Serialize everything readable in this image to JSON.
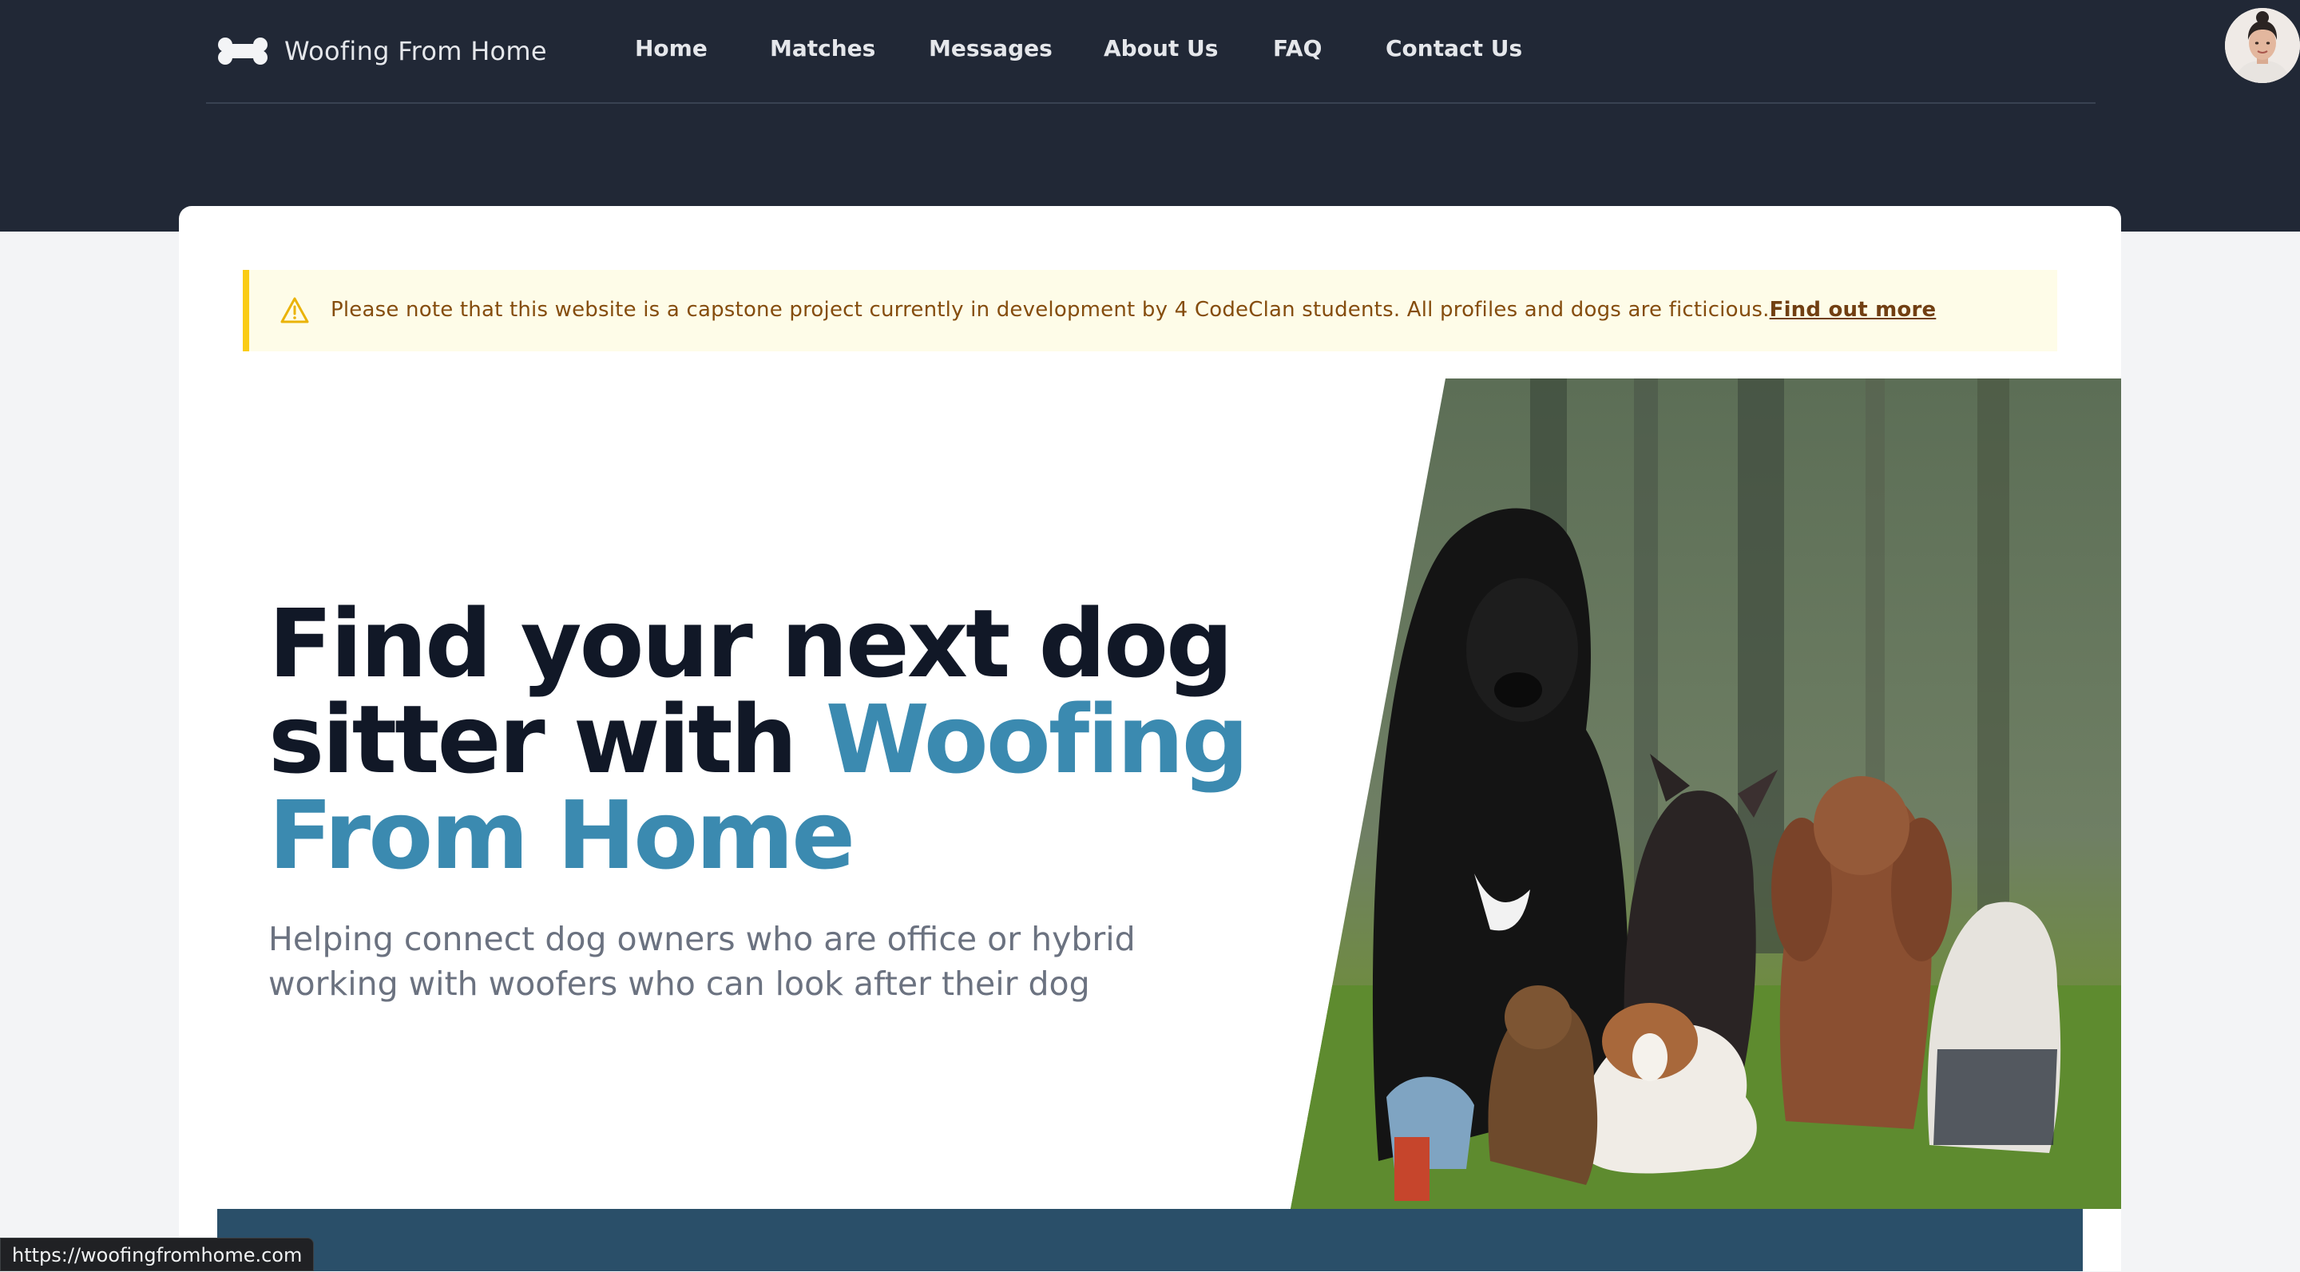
{
  "brand": {
    "name": "Woofing From Home",
    "icon": "bone-icon"
  },
  "nav": {
    "links": [
      "Home",
      "Matches",
      "Messages",
      "About Us",
      "FAQ",
      "Contact Us"
    ]
  },
  "user": {
    "avatar": "user-avatar"
  },
  "notice": {
    "icon": "warning-triangle-icon",
    "text": "Please note that this website is a capstone project currently in development by 4 CodeClan students. All profiles and dogs are ficticious.",
    "link_text": "Find out more"
  },
  "hero": {
    "title_part1": "Find your next dog sitter with ",
    "title_accent": "Woofing From Home",
    "subtitle": "Helping connect dog owners who are office or hybrid working with woofers who can look after their dog",
    "image": "group-of-dogs-photo"
  },
  "status_bar": {
    "url": "https://woofingfromhome.com"
  },
  "colors": {
    "nav_bg": "#212836",
    "accent": "#3b8ab0",
    "notice_bg": "#fefce8",
    "notice_border": "#facc15",
    "notice_text": "#854d0e",
    "strip": "#2a4f69"
  }
}
